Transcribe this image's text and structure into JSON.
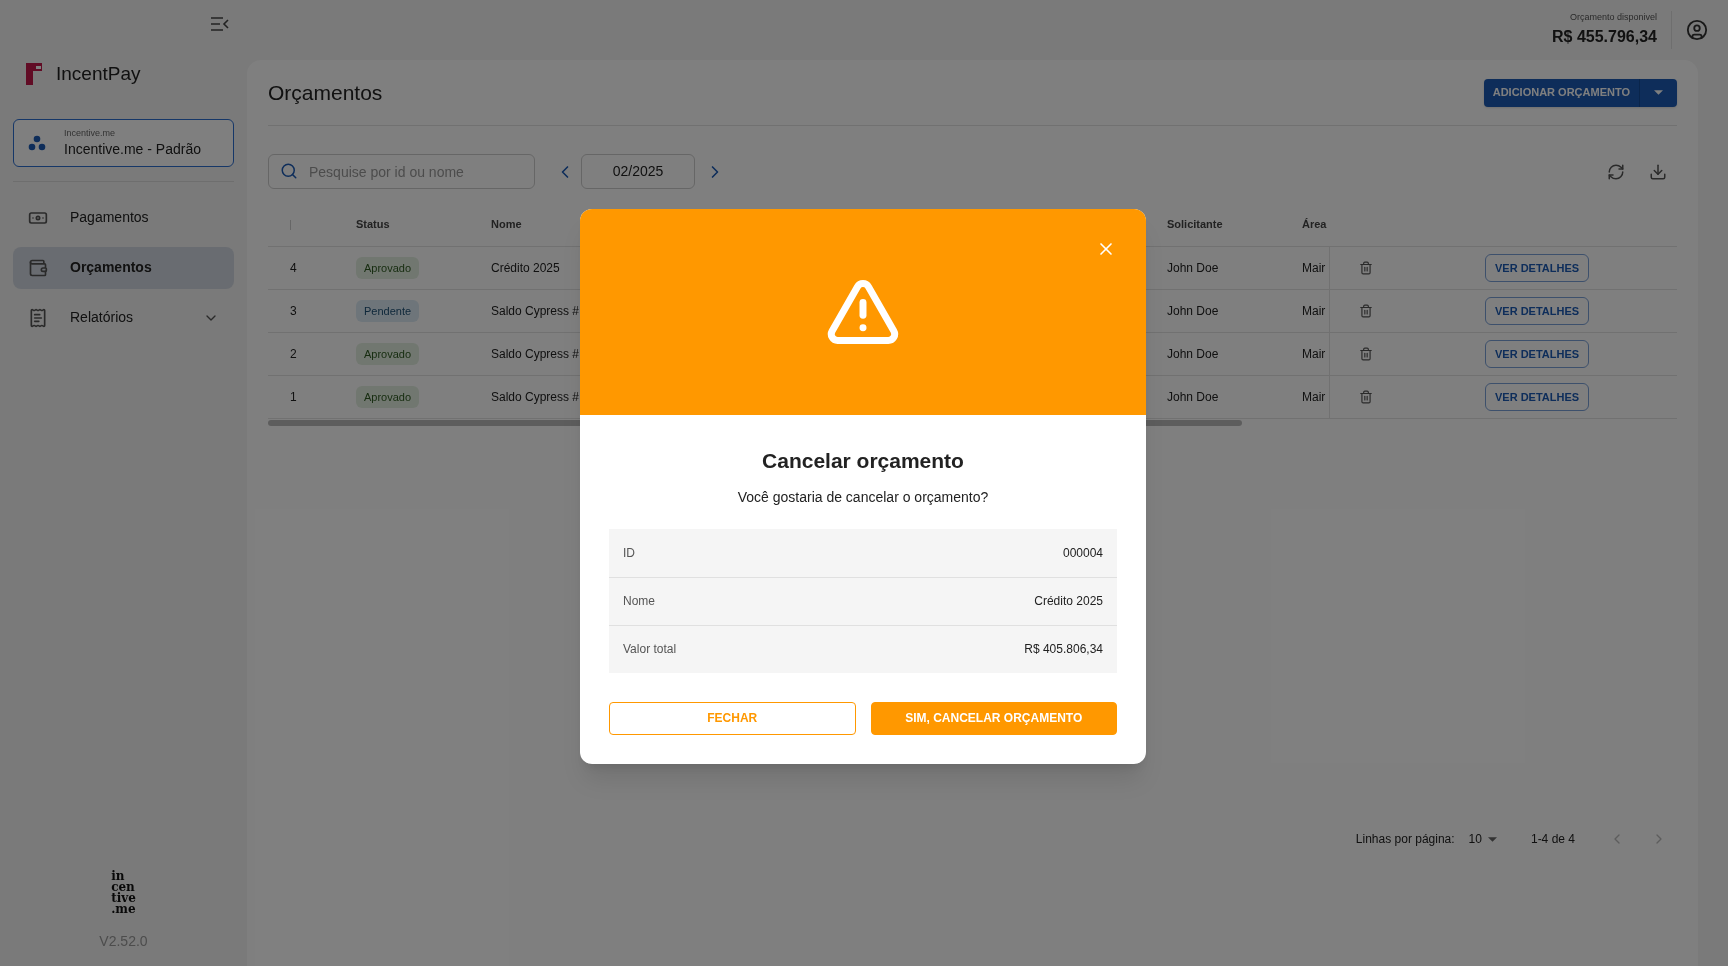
{
  "header": {
    "budget_label": "Orçamento disponivel",
    "budget_value": "R$ 455.796,34"
  },
  "sidebar": {
    "brand": "IncentPay",
    "account": {
      "caption": "Incentive.me",
      "name": "Incentive.me - Padrão"
    },
    "items": [
      {
        "label": "Pagamentos",
        "kind": "payments",
        "selected": false
      },
      {
        "label": "Orçamentos",
        "kind": "budgets",
        "selected": true
      },
      {
        "label": "Relatórios",
        "kind": "reports",
        "selected": false,
        "expanded": false
      }
    ],
    "footer_logo": [
      "in",
      "cen",
      "tive",
      ".me"
    ],
    "version": "V2.52.0"
  },
  "page": {
    "title": "Orçamentos",
    "add_button": "ADICIONAR ORÇAMENTO",
    "search": {
      "placeholder": "Pesquise por id ou nome"
    },
    "period": "02/2025"
  },
  "table": {
    "columns": [
      "Status",
      "Nome",
      "Solicitante",
      "Área"
    ],
    "rows": [
      {
        "id": "4",
        "status": {
          "label": "Aprovado",
          "kind": "approved"
        },
        "name": "Crédito 2025",
        "requester": "John Doe",
        "area": "Mair",
        "action": "VER DETALHES"
      },
      {
        "id": "3",
        "status": {
          "label": "Pendente",
          "kind": "pending"
        },
        "name": "Saldo Cypress #",
        "requester": "John Doe",
        "area": "Mair",
        "action": "VER DETALHES"
      },
      {
        "id": "2",
        "status": {
          "label": "Aprovado",
          "kind": "approved"
        },
        "name": "Saldo Cypress #",
        "requester": "John Doe",
        "area": "Mair",
        "action": "VER DETALHES"
      },
      {
        "id": "1",
        "status": {
          "label": "Aprovado",
          "kind": "approved"
        },
        "name": "Saldo Cypress #",
        "requester": "John Doe",
        "area": "Mair",
        "action": "VER DETALHES"
      }
    ]
  },
  "pagination": {
    "rows_label": "Linhas por página:",
    "rows_value": "10",
    "range": "1-4 de 4"
  },
  "dialog": {
    "title": "Cancelar orçamento",
    "message": "Você gostaria de cancelar o orçamento?",
    "details": [
      {
        "label": "ID",
        "value": "000004"
      },
      {
        "label": "Nome",
        "value": "Crédito 2025"
      },
      {
        "label": "Valor total",
        "value": "R$ 405.806,34"
      }
    ],
    "buttons": [
      {
        "label": "FECHAR",
        "kind": "outlined"
      },
      {
        "label": "SIM, CANCELAR ORÇAMENTO",
        "kind": "filled"
      }
    ]
  }
}
